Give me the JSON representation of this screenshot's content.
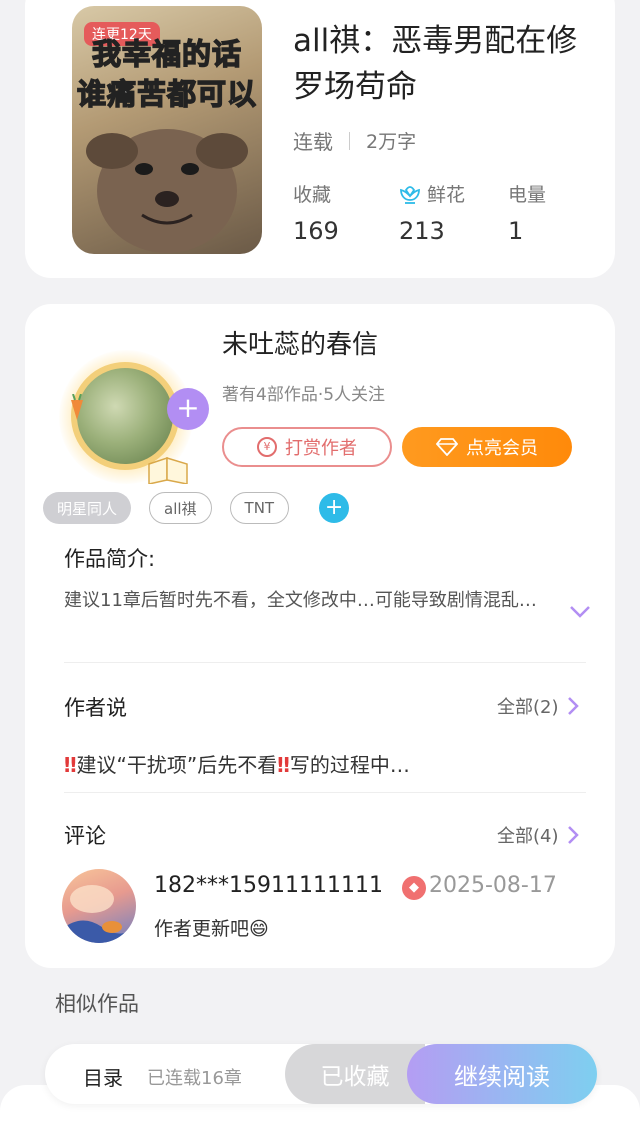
{
  "book": {
    "badge": "连更12天",
    "cover_caption": [
      "我幸福的话",
      "谁痛苦都可以"
    ],
    "title": "all祺：恶毒男配在修罗场苟命",
    "status": "连载",
    "words": "2万字",
    "stats": [
      {
        "label": "收藏",
        "value": "169",
        "icon": null
      },
      {
        "label": "鲜花",
        "value": "213",
        "icon": "flower-icon"
      },
      {
        "label": "电量",
        "value": "1",
        "icon": null
      }
    ]
  },
  "author": {
    "name": "未吐蕊的春信",
    "sub": "著有4部作品·5人关注",
    "tip_label": "打赏作者",
    "vip_label": "点亮会员"
  },
  "tags": [
    "明星同人",
    "all祺",
    "TNT"
  ],
  "intro": {
    "label": "作品简介:",
    "text": "建议11章后暂时先不看，全文修改中…可能导致剧情混乱…"
  },
  "author_says": {
    "label": "作者说",
    "more": "全部(2)",
    "text": "建议“干扰项”后先不看",
    "text2": "写的过程中…"
  },
  "comments": {
    "label": "评论",
    "more": "全部(4)",
    "user": "182***15911111111",
    "date": "2025-08-17",
    "text": "作者更新吧😄"
  },
  "similar_label": "相似作品",
  "bottom_bar": {
    "toc": "目录",
    "count": "已连载16章",
    "fav": "已收藏",
    "read": "继续阅读"
  },
  "colors": {
    "accent_purple": "#b28ef3",
    "vip_orange": "#ff9a1f",
    "tip_red": "#e26d6d"
  }
}
